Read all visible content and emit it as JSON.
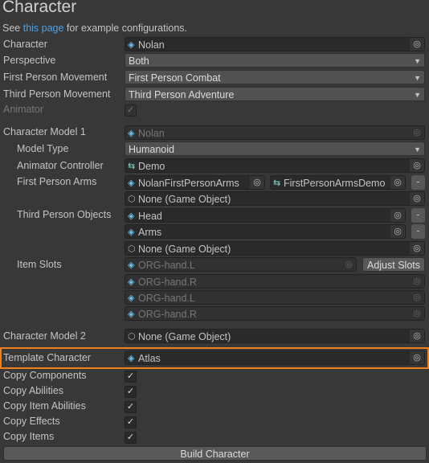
{
  "header": {
    "title": "Character",
    "see_prefix": "See ",
    "link": "this page",
    "see_suffix": " for example configurations."
  },
  "fields": {
    "character": {
      "label": "Character",
      "value": "Nolan"
    },
    "perspective": {
      "label": "Perspective",
      "value": "Both"
    },
    "fp_movement": {
      "label": "First Person Movement",
      "value": "First Person Combat"
    },
    "tp_movement": {
      "label": "Third Person Movement",
      "value": "Third Person Adventure"
    },
    "animator": {
      "label": "Animator",
      "checked": true
    },
    "model1": {
      "label": "Character Model 1",
      "value": "Nolan"
    },
    "model_type": {
      "label": "Model Type",
      "value": "Humanoid"
    },
    "anim_controller": {
      "label": "Animator Controller",
      "value": "Demo"
    },
    "fp_arms": {
      "label": "First Person Arms",
      "value": "NolanFirstPersonArms",
      "controller": "FirstPersonArmsDemo",
      "none": "None (Game Object)"
    },
    "tp_objects": {
      "label": "Third Person Objects",
      "items": [
        "Head",
        "Arms"
      ],
      "none": "None (Game Object)"
    },
    "item_slots": {
      "label": "Item Slots",
      "items": [
        "ORG-hand.L",
        "ORG-hand.R",
        "ORG-hand.L",
        "ORG-hand.R"
      ],
      "adjust": "Adjust Slots"
    },
    "model2": {
      "label": "Character Model 2",
      "value": "None (Game Object)"
    },
    "template": {
      "label": "Template Character",
      "value": "Atlas"
    }
  },
  "copy": [
    {
      "label": "Copy Components",
      "checked": true
    },
    {
      "label": "Copy Abilities",
      "checked": true
    },
    {
      "label": "Copy Item Abilities",
      "checked": true
    },
    {
      "label": "Copy Effects",
      "checked": true
    },
    {
      "label": "Copy Items",
      "checked": true
    }
  ],
  "build_label": "Build Character",
  "colors": {
    "highlight": "#f07f1c",
    "link": "#4ca3e6"
  }
}
